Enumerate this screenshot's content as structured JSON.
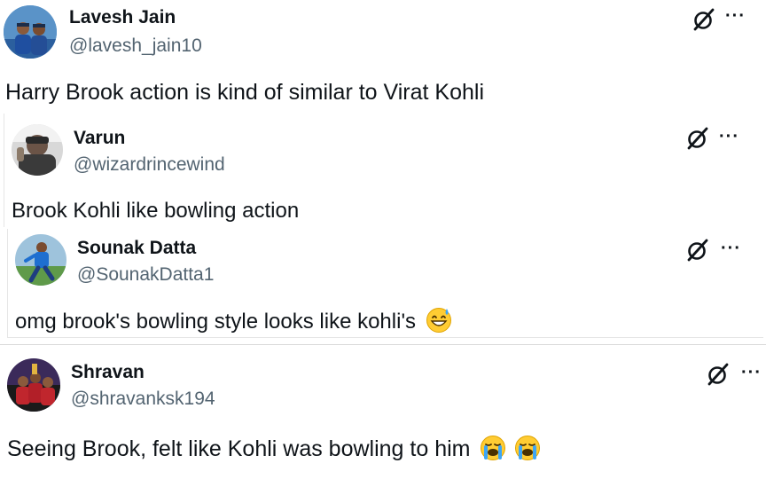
{
  "tweets": [
    {
      "name": "Lavesh Jain",
      "handle": "@lavesh_jain10",
      "text": "Harry Brook action is kind of similar to Virat Kohli",
      "emoji": []
    },
    {
      "name": "Varun",
      "handle": "@wizardrincewind",
      "text": "Brook Kohli like bowling action",
      "emoji": []
    },
    {
      "name": "Sounak Datta",
      "handle": "@SounakDatta1",
      "text": "omg brook's bowling style looks like kohli's",
      "emoji": [
        "grinning-sweat-emoji"
      ]
    },
    {
      "name": "Shravan",
      "handle": "@shravanksk194",
      "text": "Seeing Brook, felt like Kohli was bowling to him",
      "emoji": [
        "loudly-crying-emoji",
        "loudly-crying-emoji"
      ]
    }
  ],
  "icons": {
    "grok": "grok-icon",
    "more": "more-options-icon",
    "more_glyph": "···"
  },
  "colors": {
    "text": "#0f1419",
    "secondary": "#536471",
    "emoji_face": "#ffcc33",
    "tear": "#3ea6f5"
  }
}
